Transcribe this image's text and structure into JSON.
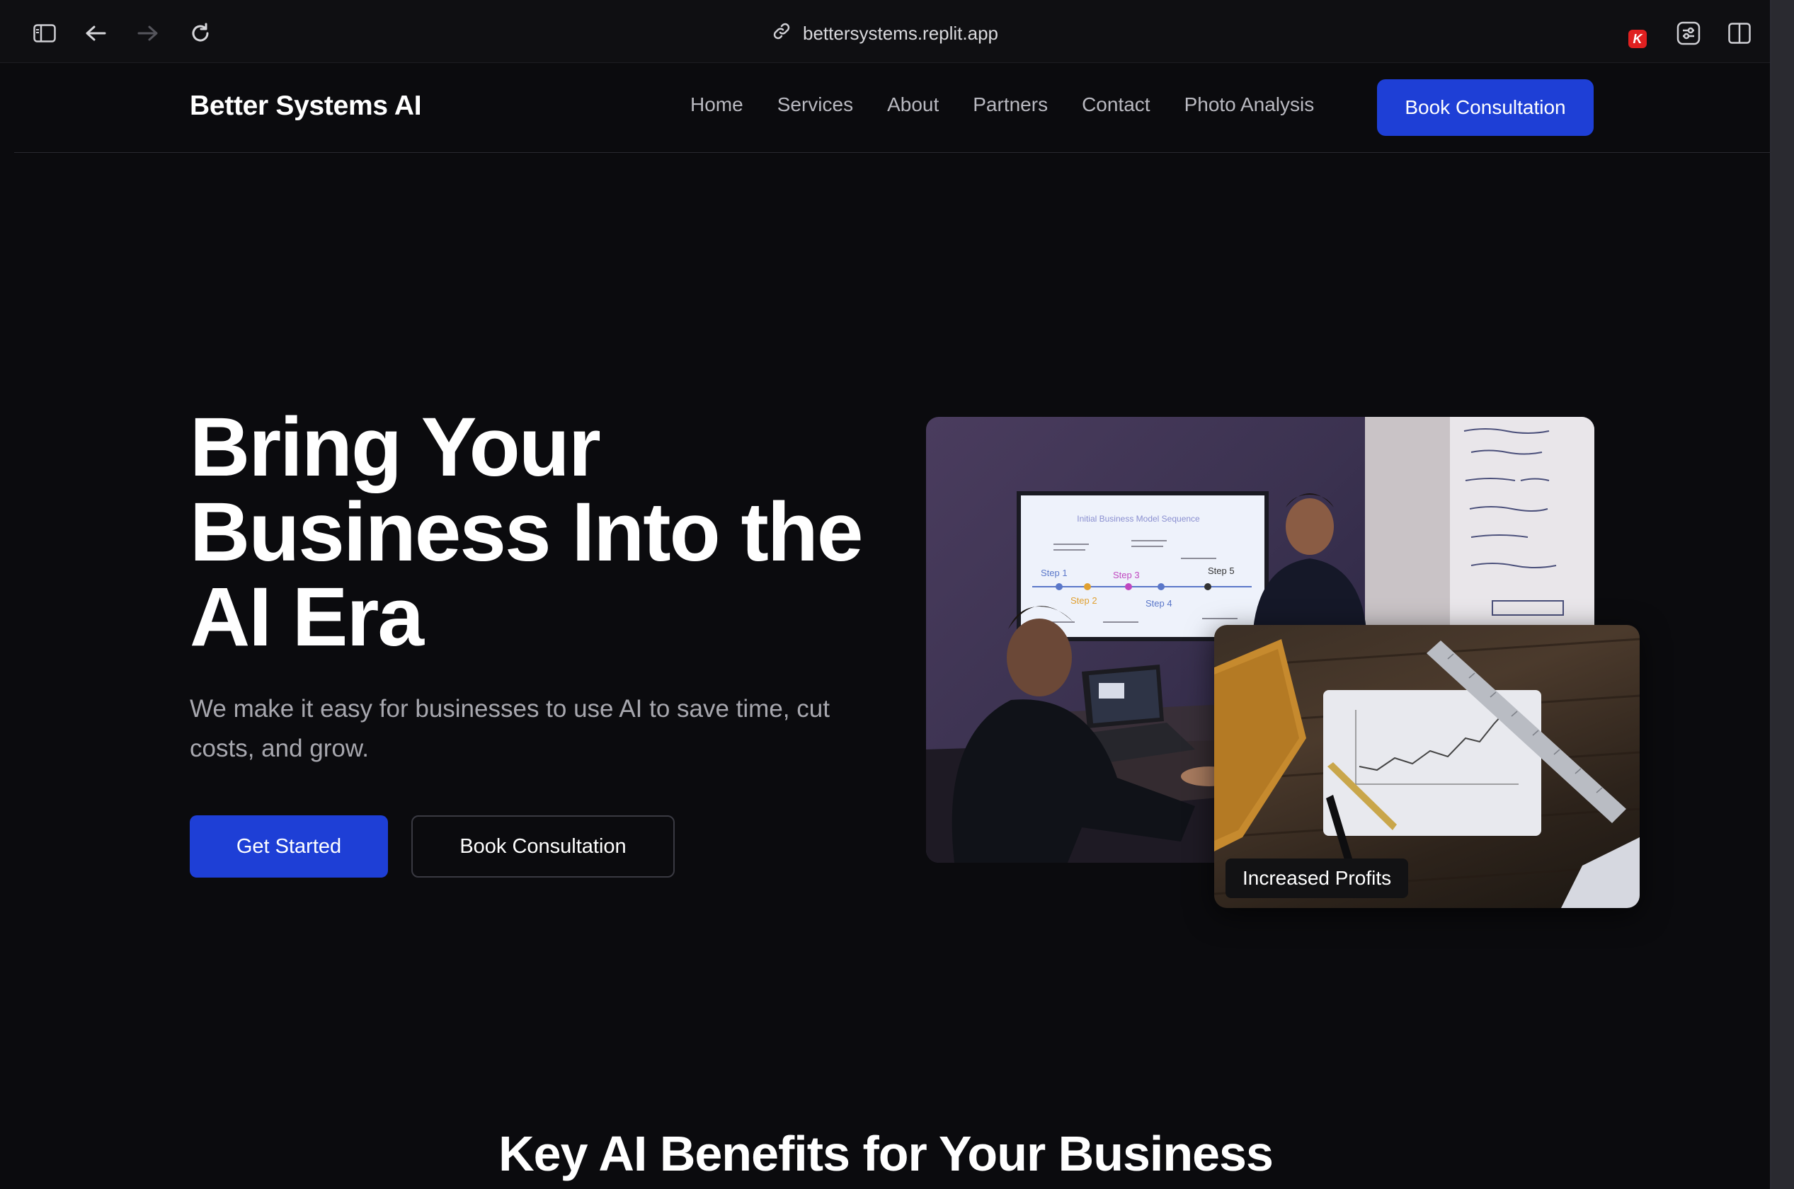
{
  "browser": {
    "url": "bettersystems.replit.app",
    "extension_badge": "K",
    "icons": [
      "sidebar-toggle-icon",
      "back-arrow-icon",
      "forward-arrow-icon",
      "reload-icon",
      "link-icon",
      "extensions-icon",
      "split-view-icon"
    ]
  },
  "nav": {
    "brand": "Better Systems AI",
    "items": [
      "Home",
      "Services",
      "About",
      "Partners",
      "Contact",
      "Photo Analysis"
    ],
    "cta": "Book Consultation"
  },
  "hero": {
    "title": "Bring Your Business Into the AI Era",
    "subtitle": "We make it easy for businesses to use AI to save time, cut costs, and grow.",
    "primary_button": "Get Started",
    "secondary_button": "Book Consultation",
    "image_main": {
      "screen_title": "Initial Business Model Sequence",
      "steps": [
        "Step 1",
        "Step 2",
        "Step 3",
        "Step 4",
        "Step 5"
      ]
    },
    "image_sub_badge": "Increased Profits"
  },
  "section": {
    "title": "Key AI Benefits for Your Business"
  },
  "colors": {
    "accent": "#1e3fd6",
    "background": "#0b0b0e",
    "text_muted": "#a7a7ae"
  }
}
